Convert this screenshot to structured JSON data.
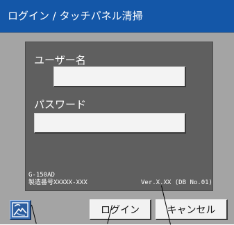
{
  "title_bar": {
    "title": "ログイン / タッチパネル清掃"
  },
  "login_form": {
    "username_label": "ユーザー名",
    "username_value": "",
    "password_label": "パスワード",
    "password_value": ""
  },
  "device_info": {
    "model": "G-150AD",
    "serial": "製造番号XXXXX-XXX",
    "version": "Ver.X.XX (DB No.01)"
  },
  "buttons": {
    "panel_icon": "touch-panel-cleaning-icon",
    "login_label": "ログイン",
    "cancel_label": "キャンセル"
  },
  "colors": {
    "title_bar": "#1457a8",
    "body_background": "#a4a4a4",
    "panel_background": "#5f5f5f",
    "icon_button": "#3b6fb4"
  }
}
